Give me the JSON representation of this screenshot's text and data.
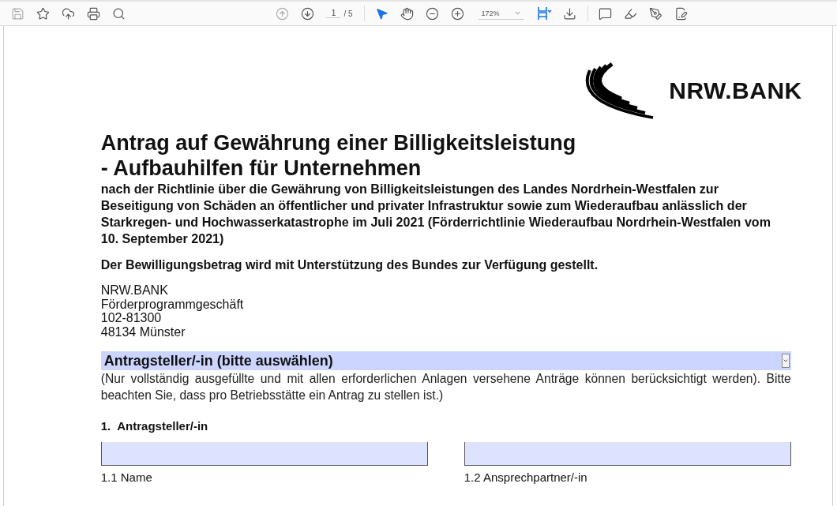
{
  "toolbar": {
    "page_current": "1",
    "page_total": "/ 5",
    "zoom": "172%"
  },
  "document": {
    "logo_text": "NRW.BANK",
    "title_lines": [
      "Antrag auf Gewährung einer Billigkeitsleistung",
      "- Aufbauhilfen für Unternehmen"
    ],
    "subtitle": "nach der Richtlinie über die Gewährung von Billigkeitsleistungen des Landes Nordrhein-Westfalen zur Beseitigung von Schäden an öffentlicher und privater Infrastruktur sowie zum Wiederaufbau anlässlich der Starkregen- und Hochwasserkatastrophe im Juli 2021 (Förderrichtlinie Wiederaufbau Nordrhein-Westfalen vom 10. September 2021)",
    "note": "Der Bewilligungsbetrag wird mit Unterstützung des Bundes zur Verfügung gestellt.",
    "address": [
      "NRW.BANK",
      "Förderprogrammgeschäft",
      "102-81300",
      "48134 Münster"
    ],
    "applicant_dropdown": {
      "value": "Antragsteller/-in (bitte auswählen)"
    },
    "instructions": "(Nur vollständig ausgefüllte und mit allen erforderlichen Anlagen versehene Anträge können berücksichtigt werden). Bitte beachten Sie, dass pro Betriebsstätte ein Antrag zu stellen ist.)",
    "section_heading": {
      "number": "1.",
      "title": "Antragsteller/-in"
    },
    "fields": [
      {
        "label": "1.1 Name"
      },
      {
        "label": "1.2 Ansprechpartner/-in"
      }
    ]
  }
}
